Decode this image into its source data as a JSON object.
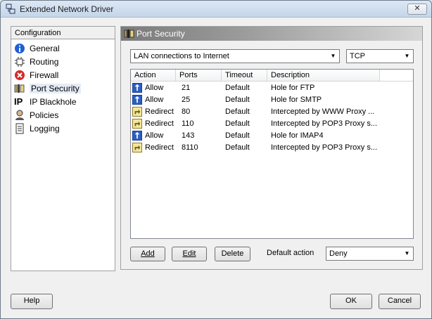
{
  "window": {
    "title": "Extended Network Driver",
    "close_label": "✕"
  },
  "sidebar": {
    "header": "Configuration",
    "items": [
      {
        "label": "General",
        "icon": "info-icon"
      },
      {
        "label": "Routing",
        "icon": "routing-icon"
      },
      {
        "label": "Firewall",
        "icon": "firewall-icon"
      },
      {
        "label": "Port Security",
        "icon": "port-security-icon",
        "selected": true
      },
      {
        "label": "IP Blackhole",
        "icon": "ip-icon"
      },
      {
        "label": "Policies",
        "icon": "policies-icon"
      },
      {
        "label": "Logging",
        "icon": "logging-icon"
      }
    ]
  },
  "main": {
    "section_title": "Port Security",
    "connection_select": "LAN connections to Internet",
    "protocol_select": "TCP",
    "columns": [
      "Action",
      "Ports",
      "Timeout",
      "Description"
    ],
    "rows": [
      {
        "action": "Allow",
        "ports": "21",
        "timeout": "Default",
        "description": "Hole for FTP",
        "type": "allow"
      },
      {
        "action": "Allow",
        "ports": "25",
        "timeout": "Default",
        "description": "Hole for SMTP",
        "type": "allow"
      },
      {
        "action": "Redirect",
        "ports": "80",
        "timeout": "Default",
        "description": "Intercepted by WWW Proxy ...",
        "type": "redirect"
      },
      {
        "action": "Redirect",
        "ports": "110",
        "timeout": "Default",
        "description": "Intercepted by POP3 Proxy s...",
        "type": "redirect"
      },
      {
        "action": "Allow",
        "ports": "143",
        "timeout": "Default",
        "description": "Hole for IMAP4",
        "type": "allow"
      },
      {
        "action": "Redirect",
        "ports": "8110",
        "timeout": "Default",
        "description": "Intercepted by POP3 Proxy s...",
        "type": "redirect"
      }
    ],
    "add_label": "Add",
    "edit_label": "Edit",
    "delete_label": "Delete",
    "default_action_label": "Default action",
    "default_action_value": "Deny"
  },
  "footer": {
    "help_label": "Help",
    "ok_label": "OK",
    "cancel_label": "Cancel"
  },
  "colors": {
    "allow_icon": "#2a5fc4",
    "redirect_icon": "#f4e79a",
    "firewall_icon": "#d42a2a",
    "info_icon": "#1f5fd6"
  }
}
